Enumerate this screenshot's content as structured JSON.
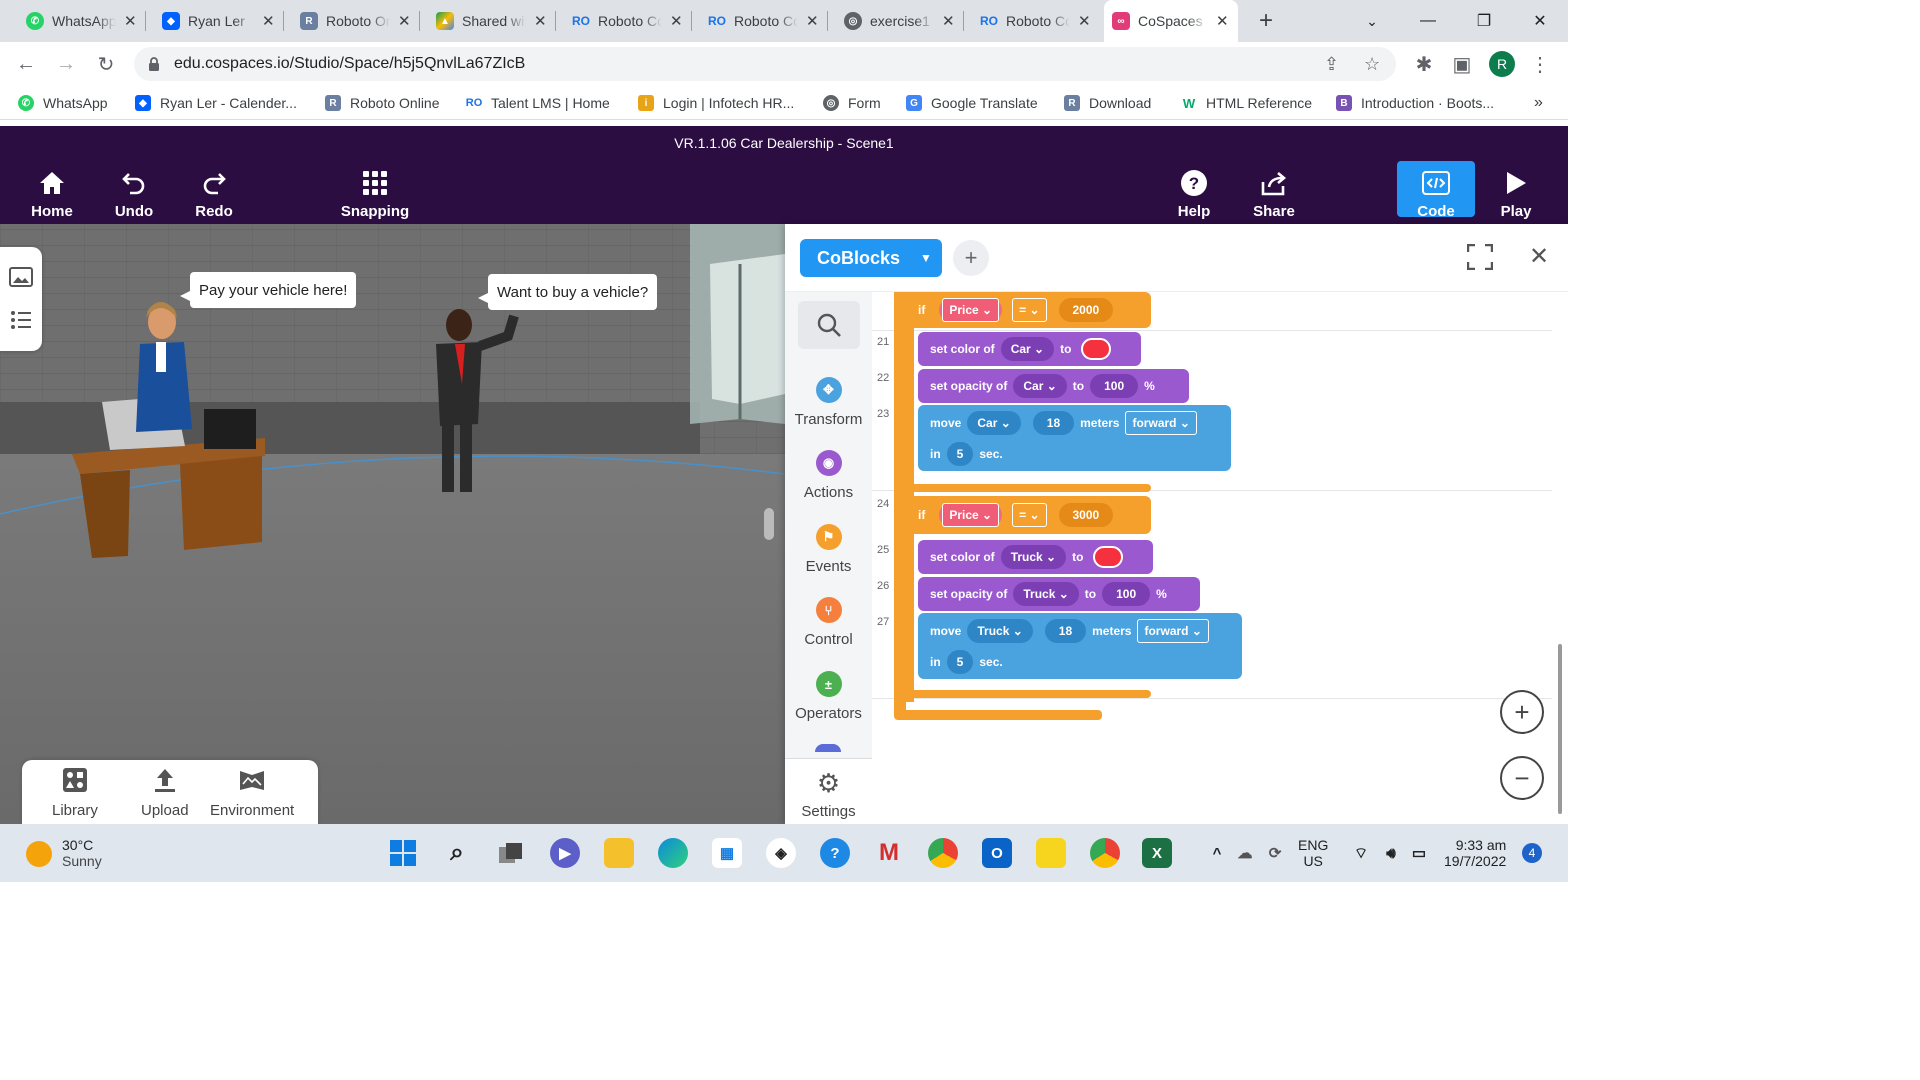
{
  "browser": {
    "tabs": [
      {
        "title": "WhatsApp",
        "icon": "whatsapp-icon",
        "color": "#25d366"
      },
      {
        "title": "Ryan Ler",
        "icon": "dropbox-icon",
        "color": "#0061fe"
      },
      {
        "title": "Roboto Online",
        "icon": "roboto-icon",
        "color": "#6b7fa0"
      },
      {
        "title": "Shared with me",
        "icon": "google-drive-icon",
        "color": "#fbbc04"
      },
      {
        "title": "Roboto Coding",
        "icon": "ro-coding-icon",
        "color": "#1a73e8"
      },
      {
        "title": "Roboto Coding",
        "icon": "ro-coding-icon",
        "color": "#1a73e8"
      },
      {
        "title": "exercise1",
        "icon": "globe-icon",
        "color": "#5f6368"
      },
      {
        "title": "Roboto Coding",
        "icon": "ro-coding-icon",
        "color": "#1a73e8"
      },
      {
        "title": "CoSpaces",
        "icon": "cospaces-icon",
        "color": "#e23b7a",
        "active": true
      }
    ],
    "url": "edu.cospaces.io/Studio/Space/h5j5QnvlLa67ZIcB",
    "profile_initial": "R",
    "bookmarks": [
      {
        "label": "WhatsApp",
        "icon": "whatsapp-icon",
        "color": "#25d366"
      },
      {
        "label": "Ryan Ler - Calender...",
        "icon": "dropbox-icon",
        "color": "#0061fe"
      },
      {
        "label": "Roboto Online",
        "icon": "roboto-icon",
        "color": "#6b7fa0"
      },
      {
        "label": "Talent LMS | Home",
        "icon": "ro-coding-icon",
        "color": "#1a73e8"
      },
      {
        "label": "Login | Infotech HR...",
        "icon": "infotech-icon",
        "color": "#e8a317"
      },
      {
        "label": "Form",
        "icon": "globe-icon",
        "color": "#5f6368"
      },
      {
        "label": "Google Translate",
        "icon": "google-translate-icon",
        "color": "#4285f4"
      },
      {
        "label": "Download",
        "icon": "roboto-icon",
        "color": "#6b7fa0"
      },
      {
        "label": "HTML Reference",
        "icon": "w3schools-icon",
        "color": "#04aa6d"
      },
      {
        "label": "Introduction · Boots...",
        "icon": "bootstrap-icon",
        "color": "#7952b3"
      }
    ]
  },
  "cospaces": {
    "title": "VR.1.1.06 Car Dealership - Scene1",
    "header_buttons": {
      "home": "Home",
      "undo": "Undo",
      "redo": "Redo",
      "snapping": "Snapping",
      "help": "Help",
      "share": "Share",
      "code": "Code",
      "play": "Play"
    },
    "scene": {
      "bubble_left": "Pay your vehicle here!",
      "bubble_right": "Want to buy a vehicle?"
    },
    "bottom_tools": {
      "library": "Library",
      "upload": "Upload",
      "environment": "Environment"
    },
    "code_panel": {
      "mode": "CoBlocks",
      "categories": [
        {
          "label": "Transform",
          "color": "#4aa3df",
          "icon": "transform-icon"
        },
        {
          "label": "Actions",
          "color": "#9b59d0",
          "icon": "eye-icon"
        },
        {
          "label": "Events",
          "color": "#f5a02d",
          "icon": "flag-icon"
        },
        {
          "label": "Control",
          "color": "#f5803d",
          "icon": "branch-icon"
        },
        {
          "label": "Operators",
          "color": "#4caf50",
          "icon": "operators-icon"
        }
      ],
      "settings": "Settings",
      "block_group_1": {
        "if_kw": "if",
        "variable": "Price",
        "operator": "=",
        "value": "2000",
        "line_numbers": [
          "21",
          "22",
          "23"
        ],
        "set_color": {
          "label": "set color of",
          "target": "Car",
          "to": "to"
        },
        "set_opacity": {
          "label": "set opacity of",
          "target": "Car",
          "to": "to",
          "value": "100",
          "unit": "%"
        },
        "move": {
          "label": "move",
          "target": "Car",
          "distance": "18",
          "unit": "meters",
          "direction": "forward",
          "in": "in",
          "time": "5",
          "time_unit": "sec."
        }
      },
      "block_group_2": {
        "if_kw": "if",
        "variable": "Price",
        "operator": "=",
        "value": "3000",
        "line_numbers": [
          "24",
          "25",
          "26",
          "27"
        ],
        "set_color": {
          "label": "set color of",
          "target": "Truck",
          "to": "to"
        },
        "set_opacity": {
          "label": "set opacity of",
          "target": "Truck",
          "to": "to",
          "value": "100",
          "unit": "%"
        },
        "move": {
          "label": "move",
          "target": "Truck",
          "distance": "18",
          "unit": "meters",
          "direction": "forward",
          "in": "in",
          "time": "5",
          "time_unit": "sec."
        }
      }
    }
  },
  "taskbar": {
    "weather_temp": "30°C",
    "weather_desc": "Sunny",
    "lang_top": "ENG",
    "lang_bottom": "US",
    "time": "9:33 am",
    "date": "19/7/2022",
    "notifications": "4"
  }
}
